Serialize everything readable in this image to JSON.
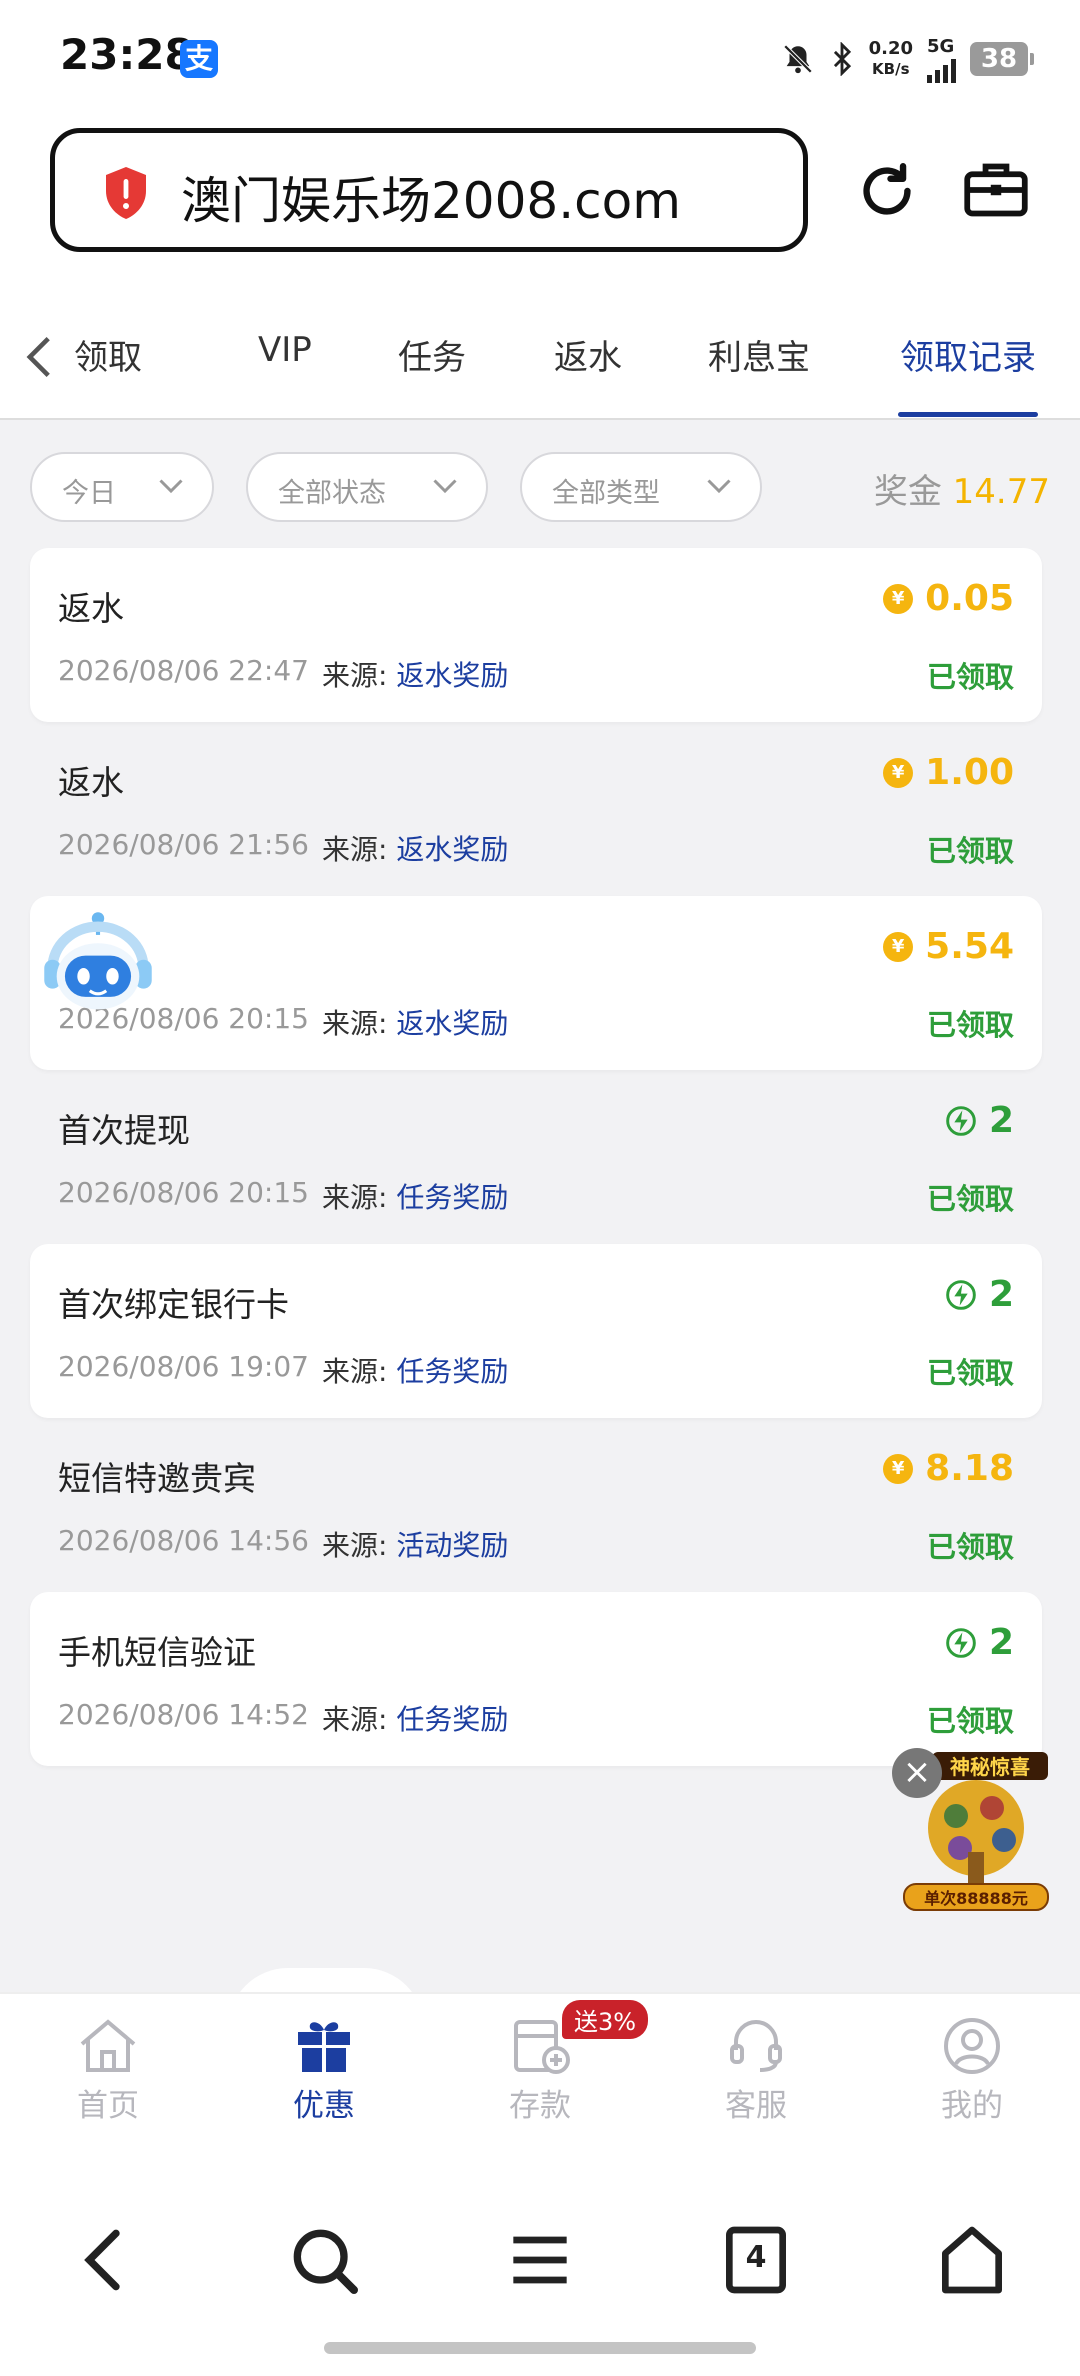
{
  "status_bar": {
    "time": "23:28",
    "app_icon": "支",
    "speed_value": "0.20",
    "speed_unit": "KB/s",
    "network": "5G",
    "battery": "38"
  },
  "browser": {
    "url": "澳门娱乐场2008.com"
  },
  "tabs": [
    "领取",
    "VIP",
    "任务",
    "返水",
    "利息宝",
    "领取记录"
  ],
  "filters": {
    "date": "今日",
    "status": "全部状态",
    "type": "全部类型",
    "bonus_label": "奖金",
    "bonus_value": "14.77"
  },
  "records": [
    {
      "title": "返水",
      "date": "2026/08/06 22:47",
      "source_label": "来源:",
      "source": "返水奖励",
      "amount": "0.05",
      "kind": "yen",
      "status": "已领取"
    },
    {
      "title": "返水",
      "date": "2026/08/06 21:56",
      "source_label": "来源:",
      "source": "返水奖励",
      "amount": "1.00",
      "kind": "yen",
      "status": "已领取"
    },
    {
      "title": "",
      "date": "2026/08/06 20:15",
      "source_label": "来源:",
      "source": "返水奖励",
      "amount": "5.54",
      "kind": "yen",
      "status": "已领取"
    },
    {
      "title": "首次提现",
      "date": "2026/08/06 20:15",
      "source_label": "来源:",
      "source": "任务奖励",
      "amount": "2",
      "kind": "energy",
      "status": "已领取"
    },
    {
      "title": "首次绑定银行卡",
      "date": "2026/08/06 19:07",
      "source_label": "来源:",
      "source": "任务奖励",
      "amount": "2",
      "kind": "energy",
      "status": "已领取"
    },
    {
      "title": "短信特邀贵宾",
      "date": "2026/08/06 14:56",
      "source_label": "来源:",
      "source": "活动奖励",
      "amount": "8.18",
      "kind": "yen",
      "status": "已领取"
    },
    {
      "title": "手机短信验证",
      "date": "2026/08/06 14:52",
      "source_label": "来源:",
      "source": "任务奖励",
      "amount": "2",
      "kind": "energy",
      "status": "已领取"
    }
  ],
  "promo": {
    "title": "神秘惊喜",
    "subtitle": "单次88888元"
  },
  "bottom_nav": {
    "home": "首页",
    "promo": "优惠",
    "deposit": "存款",
    "deposit_badge": "送3%",
    "service": "客服",
    "mine": "我的"
  },
  "browser_nav": {
    "tab_count": "4"
  },
  "colors": {
    "accent": "#1c3ea0",
    "gold": "#f5b50f",
    "green": "#2e9e3a"
  }
}
